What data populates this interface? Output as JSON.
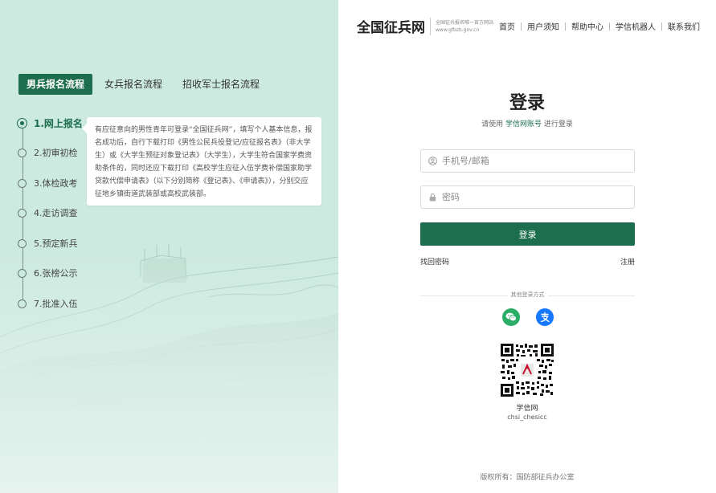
{
  "left": {
    "tabs": [
      {
        "label": "男兵报名流程",
        "active": true
      },
      {
        "label": "女兵报名流程",
        "active": false
      },
      {
        "label": "招收军士报名流程",
        "active": false
      }
    ],
    "steps": [
      {
        "label": "1.网上报名",
        "active": true
      },
      {
        "label": "2.初审初检",
        "active": false
      },
      {
        "label": "3.体检政考",
        "active": false
      },
      {
        "label": "4.走访调查",
        "active": false
      },
      {
        "label": "5.预定新兵",
        "active": false
      },
      {
        "label": "6.张榜公示",
        "active": false
      },
      {
        "label": "7.批准入伍",
        "active": false
      }
    ],
    "tip": "有应征意向的男性青年可登录“全国征兵网”，填写个人基本信息，报名成功后，自行下载打印《男性公民兵役登记/应征报名表》（非大学生）或《大学生预征对象登记表》（大学生），大学生符合国家学费资助条件的，同时还应下载打印《高校学生应征入伍学费补偿国家助学贷款代偿申请表》（以下分别简称《登记表》、《申请表》），分别交应征地乡镇街道武装部或高校武装部。"
  },
  "header": {
    "site_title": "全国征兵网",
    "site_subtitle": "全国征兵报名唯一官方网站",
    "site_url": "www.gfbzb.gov.cn",
    "nav": [
      "首页",
      "用户须知",
      "帮助中心",
      "学信机器人",
      "联系我们"
    ]
  },
  "login": {
    "title": "登录",
    "subtitle_prefix": "请使用",
    "subtitle_account": "学信网账号",
    "subtitle_suffix": "进行登录",
    "username_placeholder": "手机号/邮箱",
    "password_placeholder": "密码",
    "submit_label": "登录",
    "forgot_label": "找回密码",
    "register_label": "注册",
    "other_methods": "其他登录方式",
    "social": [
      {
        "icon": "wechat-icon",
        "color": "#2aae67"
      },
      {
        "icon": "alipay-icon",
        "color": "#1677ff"
      }
    ],
    "qr_name": "学信网",
    "qr_account": "chsi_chesicc"
  },
  "footer": {
    "copyright": "版权所有：国防部征兵办公室"
  },
  "colors": {
    "primary": "#1d6d4f",
    "left_bg": "#cdeae0"
  }
}
